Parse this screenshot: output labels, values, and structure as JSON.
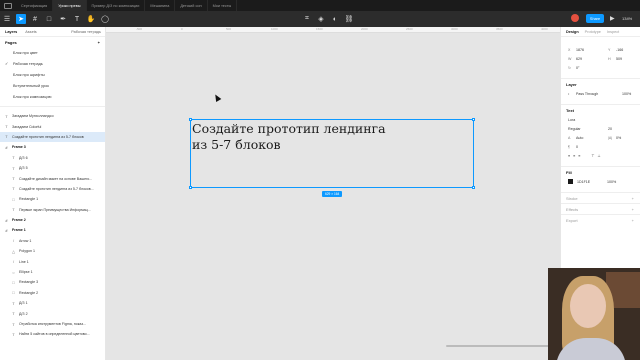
{
  "tabs": [
    "Сертификация",
    "Уроки превы",
    "Пример Д/З по композиции",
    "Мешанина",
    "Детский сон",
    "Мои тесты"
  ],
  "toolbar": {
    "share_label": "Share",
    "zoom": "134%"
  },
  "layers_panel": {
    "tab_layers": "Layers",
    "tab_assets": "Assets",
    "page_selector": "Рабочая тетрадь",
    "pages_title": "Pages",
    "add": "+",
    "pages": [
      "Блок про цвет",
      "Рабочая тетрадь",
      "Блок про шрифты",
      "Вступительный урок",
      "Блок про композицию"
    ],
    "layers": [
      {
        "label": "Загадаем Мунхолландсо",
        "type": "text"
      },
      {
        "label": "Загадаем Colorful",
        "type": "text"
      },
      {
        "label": "Создайте прототип лендинга из 5-7 блоков",
        "type": "text",
        "selected": true
      },
      {
        "label": "Frame 3",
        "type": "frame"
      },
      {
        "label": "Д/З 6",
        "type": "text",
        "indent": 1
      },
      {
        "label": "Д/З 5",
        "type": "text",
        "indent": 1
      },
      {
        "label": "Создайте дизайн макет на основе Вашего...",
        "type": "text",
        "indent": 1
      },
      {
        "label": "Создайте прототип лендинга из 5-7 блоков...",
        "type": "text",
        "indent": 1
      },
      {
        "label": "Rectangle 1",
        "type": "rect",
        "indent": 1
      },
      {
        "label": "Первые экран Преимущества Информац...",
        "type": "text",
        "indent": 1
      },
      {
        "label": "Frame 2",
        "type": "frame"
      },
      {
        "label": "Frame 1",
        "type": "frame"
      },
      {
        "label": "Arrow 1",
        "type": "line",
        "indent": 1
      },
      {
        "label": "Polygon 1",
        "type": "poly",
        "indent": 1
      },
      {
        "label": "Line 1",
        "type": "line",
        "indent": 1
      },
      {
        "label": "Ellipse 1",
        "type": "ellipse",
        "indent": 1
      },
      {
        "label": "Rectangle 3",
        "type": "rect",
        "indent": 1
      },
      {
        "label": "Rectangle 2",
        "type": "rect",
        "indent": 1
      },
      {
        "label": "Д/З 1",
        "type": "text",
        "indent": 1
      },
      {
        "label": "Д/З 2",
        "type": "text",
        "indent": 1
      },
      {
        "label": "Отработка инструментов Figma, показ...",
        "type": "text",
        "indent": 1
      },
      {
        "label": "Найти 5 сайтов в определенной цветово...",
        "type": "text",
        "indent": 1
      }
    ]
  },
  "canvas": {
    "ruler_ticks": [
      "-500",
      "0",
      "500",
      "1000",
      "1500",
      "2000",
      "2500",
      "3000",
      "3500",
      "4000"
    ],
    "heading_line1": "Создайте прототип лендинга",
    "heading_line2": "из 5-7 блоков",
    "size_badge": "629 × 164"
  },
  "design_panel": {
    "tab_design": "Design",
    "tab_prototype": "Prototype",
    "tab_inspect": "Inspect",
    "x": "1876",
    "y": "-166",
    "w": "629",
    "h": "509",
    "rotation": "0°",
    "layer_title": "Layer",
    "blend": "Pass Through",
    "opacity": "100%",
    "text_title": "Text",
    "font": "Lora",
    "weight": "Regular",
    "size": "20",
    "line_height": "Auto",
    "letter_spacing": "0%",
    "para": "0",
    "fill_title": "Fill",
    "fill_hex": "1D1F1E",
    "fill_opacity": "100%",
    "stroke_title": "Stroke",
    "effects_title": "Effects",
    "export_title": "Export"
  }
}
